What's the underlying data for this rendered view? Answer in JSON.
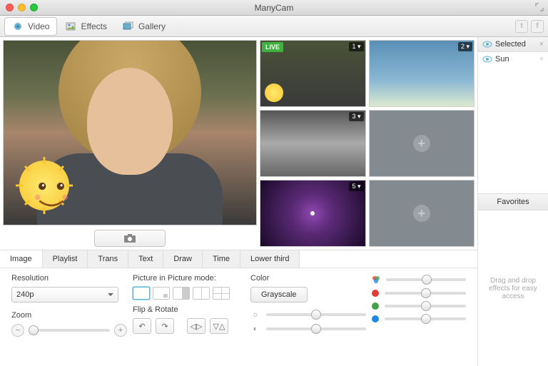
{
  "app": {
    "title": "ManyCam"
  },
  "toolbar": {
    "tabs": [
      {
        "label": "Video"
      },
      {
        "label": "Effects"
      },
      {
        "label": "Gallery"
      }
    ]
  },
  "thumbs": {
    "live_label": "LIVE",
    "items": [
      {
        "num": "1"
      },
      {
        "num": "2"
      },
      {
        "num": "3"
      },
      {
        "num": "5"
      }
    ]
  },
  "ctabs": [
    {
      "label": "Image"
    },
    {
      "label": "Playlist"
    },
    {
      "label": "Trans"
    },
    {
      "label": "Text"
    },
    {
      "label": "Draw"
    },
    {
      "label": "Time"
    },
    {
      "label": "Lower third"
    }
  ],
  "controls": {
    "resolution_label": "Resolution",
    "resolution_value": "240p",
    "zoom_label": "Zoom",
    "pip_label": "Picture in Picture mode:",
    "flip_label": "Flip & Rotate",
    "color_label": "Color",
    "grayscale_label": "Grayscale"
  },
  "sidebar": {
    "selected_label": "Selected",
    "effect_name": "Sun",
    "favorites_label": "Favorites",
    "drag_hint": "Drag and drop effects for easy access"
  }
}
